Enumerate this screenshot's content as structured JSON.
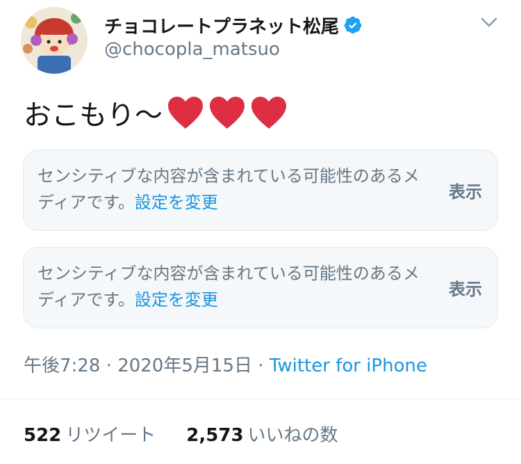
{
  "user": {
    "display_name": "チョコレートプラネット松尾",
    "handle": "@chocopla_matsuo",
    "verified": true,
    "avatar_icon": "avatar-image"
  },
  "tweet": {
    "text": "おこもり〜",
    "emoji": [
      "red-heart",
      "red-heart",
      "red-heart"
    ]
  },
  "media_warnings": [
    {
      "text": "センシティブな内容が含まれている可能性のあるメディアです。",
      "link": "設定を変更",
      "button": "表示"
    },
    {
      "text": "センシティブな内容が含まれている可能性のあるメディアです。",
      "link": "設定を変更",
      "button": "表示"
    }
  ],
  "meta": {
    "time": "午後7:28",
    "separator": "·",
    "date": "2020年5月15日",
    "source": "Twitter for iPhone"
  },
  "stats": {
    "retweets_count": "522",
    "retweets_label": "リツイート",
    "likes_count": "2,573",
    "likes_label": "いいねの数"
  },
  "colors": {
    "primary_text": "#14171a",
    "secondary_text": "#657786",
    "link": "#1b95e0",
    "verified": "#1da1f2",
    "heart": "#dd2e44",
    "card_bg": "#f5f8fa",
    "card_border": "#e1e8ed"
  }
}
